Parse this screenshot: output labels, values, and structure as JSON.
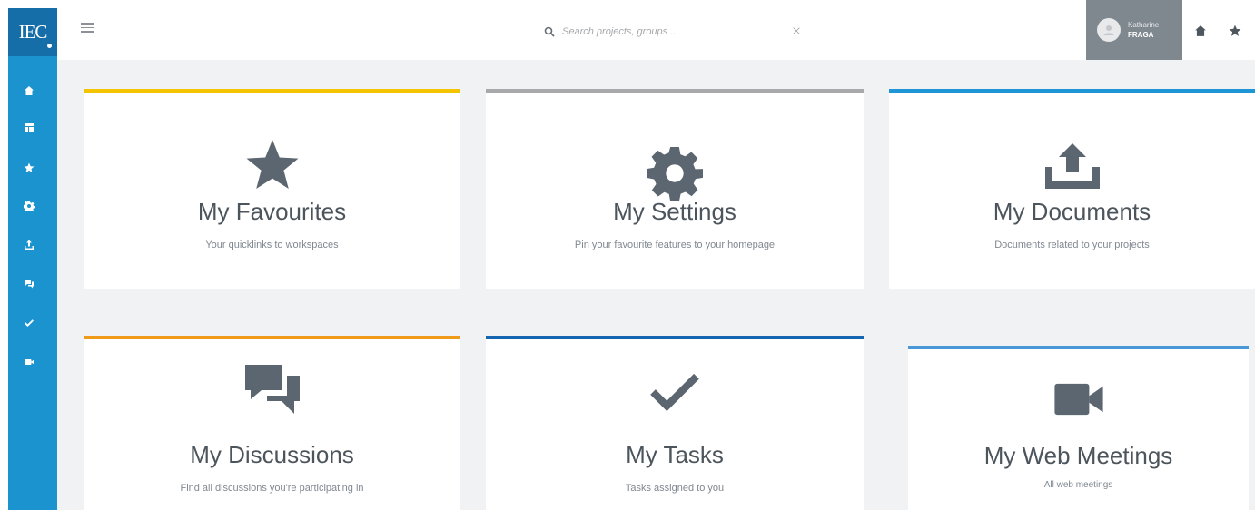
{
  "brand": {
    "logo_text": "IEC",
    "accent": "#1a93cf",
    "logo_bg": "#166ea8"
  },
  "sidebar": {
    "items": [
      {
        "name": "home",
        "icon": "home-icon"
      },
      {
        "name": "dashboard",
        "icon": "dashboard-icon"
      },
      {
        "name": "favourites",
        "icon": "star-icon"
      },
      {
        "name": "settings",
        "icon": "gear-icon"
      },
      {
        "name": "documents",
        "icon": "upload-icon"
      },
      {
        "name": "discussions",
        "icon": "chat-icon"
      },
      {
        "name": "tasks",
        "icon": "check-icon"
      },
      {
        "name": "web-meetings",
        "icon": "video-icon"
      }
    ]
  },
  "header": {
    "search": {
      "placeholder": "Search projects, groups ...",
      "value": ""
    },
    "user": {
      "first_name": "Katharine",
      "last_name": "FRAGA"
    }
  },
  "cards": [
    {
      "title": "My Favourites",
      "subtitle": "Your quicklinks to workspaces",
      "icon": "star-icon",
      "accent": "#f5c400"
    },
    {
      "title": "My Settings",
      "subtitle": "Pin your favourite features to your homepage",
      "icon": "gear-icon",
      "accent": "#a7a9ab"
    },
    {
      "title": "My Documents",
      "subtitle": "Documents related to your projects",
      "icon": "upload-icon",
      "accent": "#1e96d5"
    },
    {
      "title": "My Discussions",
      "subtitle": "Find all discussions you're participating in",
      "icon": "chat-icon",
      "accent": "#f09a1a"
    },
    {
      "title": "My Tasks",
      "subtitle": "Tasks assigned to you",
      "icon": "check-icon",
      "accent": "#1565b0"
    },
    {
      "title": "My Web Meetings",
      "subtitle": "All web meetings",
      "icon": "video-icon",
      "accent": "#4a98d8"
    }
  ]
}
